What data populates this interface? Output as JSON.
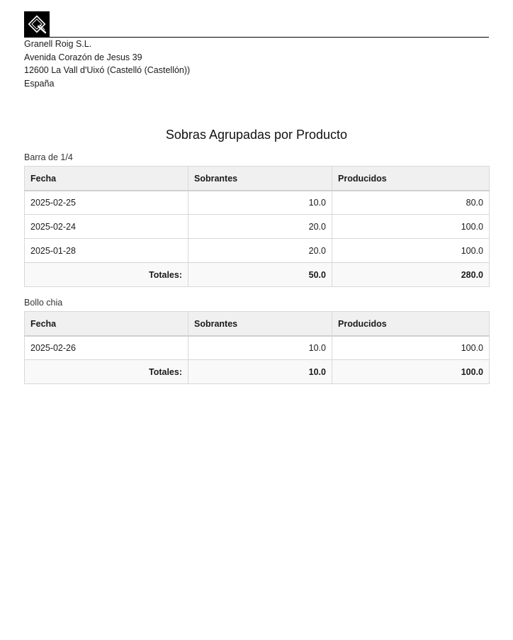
{
  "logo": {
    "icon": "bakery-logo-icon",
    "background": "#000000"
  },
  "company": {
    "name": "Granell Roig S.L.",
    "street": "Avenida Corazón de Jesus 39",
    "city": "12600 La Vall d'Uixó (Castelló (Castellón))",
    "country": "España"
  },
  "report": {
    "title": "Sobras Agrupadas por Producto"
  },
  "columns": {
    "date": "Fecha",
    "leftover": "Sobrantes",
    "produced": "Producidos"
  },
  "groups": [
    {
      "product": "Barra de 1/4",
      "rows": [
        {
          "date": "2025-02-25",
          "leftover": "10.0",
          "produced": "80.0"
        },
        {
          "date": "2025-02-24",
          "leftover": "20.0",
          "produced": "100.0"
        },
        {
          "date": "2025-01-28",
          "leftover": "20.0",
          "produced": "100.0"
        }
      ],
      "totals": {
        "label": "Totales:",
        "leftover": "50.0",
        "produced": "280.0"
      }
    },
    {
      "product": "Bollo chia",
      "rows": [
        {
          "date": "2025-02-26",
          "leftover": "10.0",
          "produced": "100.0"
        }
      ],
      "totals": {
        "label": "Totales:",
        "leftover": "10.0",
        "produced": "100.0"
      }
    }
  ],
  "colors": {
    "header_bg": "#f0f0f0",
    "border": "#d8d8d8",
    "text": "#1a1a1a"
  }
}
